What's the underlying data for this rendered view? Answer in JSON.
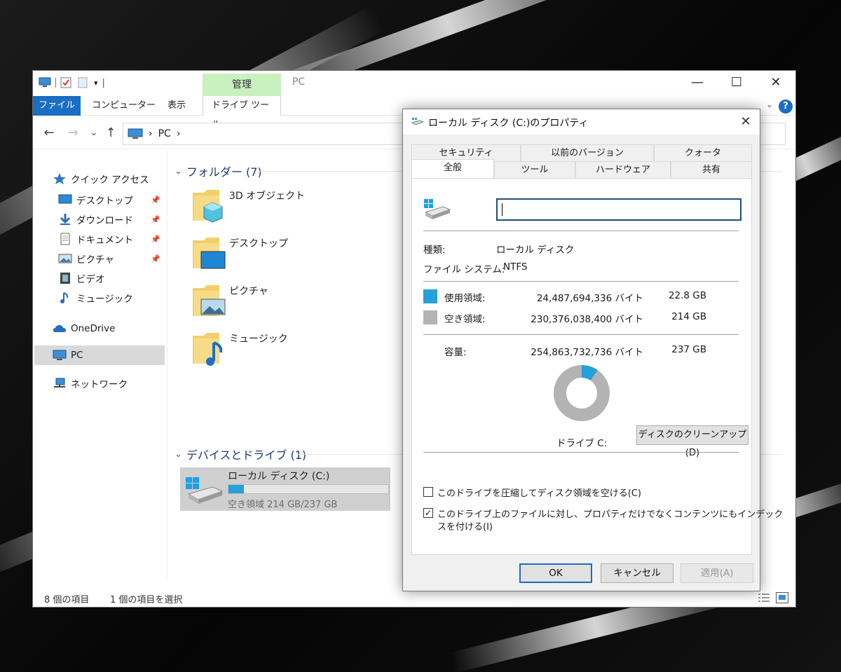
{
  "explorer": {
    "quick_access_toolbar_separator": "|",
    "manage_tab": "管理",
    "window_title": "PC",
    "controls": {
      "minimize": "—",
      "maximize": "☐",
      "close": "✕"
    },
    "ribbon": {
      "file": "ファイル",
      "computer": "コンピューター",
      "view": "表示",
      "drive_tools": "ドライブ ツール",
      "collapse": "⌄",
      "help": "?"
    },
    "nav": {
      "back": "←",
      "forward": "→",
      "recent": "⌄",
      "up": "↑"
    },
    "address": {
      "sep1": "›",
      "location": "PC",
      "sep2": "›"
    },
    "sidebar": {
      "quick_access": "クイック アクセス",
      "items": [
        {
          "label": "デスクトップ",
          "pinned": true
        },
        {
          "label": "ダウンロード",
          "pinned": true
        },
        {
          "label": "ドキュメント",
          "pinned": true
        },
        {
          "label": "ピクチャ",
          "pinned": true
        },
        {
          "label": "ビデオ",
          "pinned": false
        },
        {
          "label": "ミュージック",
          "pinned": false
        }
      ],
      "onedrive": "OneDrive",
      "pc": "PC",
      "network": "ネットワーク",
      "pin_glyph": "📌"
    },
    "folders_header": "フォルダー (7)",
    "folders": [
      "3D オブジェクト",
      "デスクトップ",
      "ピクチャ",
      "ミュージック"
    ],
    "devices_header": "デバイスとドライブ (1)",
    "drive": {
      "name": "ローカル ディスク (C:)",
      "free_text": "空き領域 214 GB/237 GB",
      "used_fraction": 0.097
    },
    "status": {
      "count": "8 個の項目",
      "selected": "1 個の項目を選択"
    }
  },
  "dialog": {
    "title": "ローカル ディスク (C:)のプロパティ",
    "close": "✕",
    "tabs_back": [
      "セキュリティ",
      "以前のバージョン",
      "クォータ"
    ],
    "tabs_front": [
      "全般",
      "ツール",
      "ハードウェア",
      "共有"
    ],
    "name_value": "",
    "type_label": "種類:",
    "type_value": "ローカル ディスク",
    "fs_label": "ファイル システム:",
    "fs_value": "NTFS",
    "used_label": "使用領域:",
    "used_bytes": "24,487,694,336 バイト",
    "used_gb": "22.8 GB",
    "free_label": "空き領域:",
    "free_bytes": "230,376,038,400 バイト",
    "free_gb": "214 GB",
    "capacity_label": "容量:",
    "capacity_bytes": "254,863,732,736 バイト",
    "capacity_gb": "237 GB",
    "drive_label": "ドライブ C:",
    "cleanup_button": "ディスクのクリーンアップ(D)",
    "compress_label": "このドライブを圧縮してディスク領域を空ける(C)",
    "compress_checked": false,
    "index_label_line1": "このドライブ上のファイルに対し、プロパティだけでなくコンテンツにもインデック",
    "index_label_line2": "スを付ける(I)",
    "index_checked": true,
    "check_mark": "✓",
    "ok": "OK",
    "cancel": "キャンセル",
    "apply": "適用(A)",
    "used_color": "#26a0da",
    "free_color": "#b3b3b3",
    "used_fraction": 0.0961
  }
}
